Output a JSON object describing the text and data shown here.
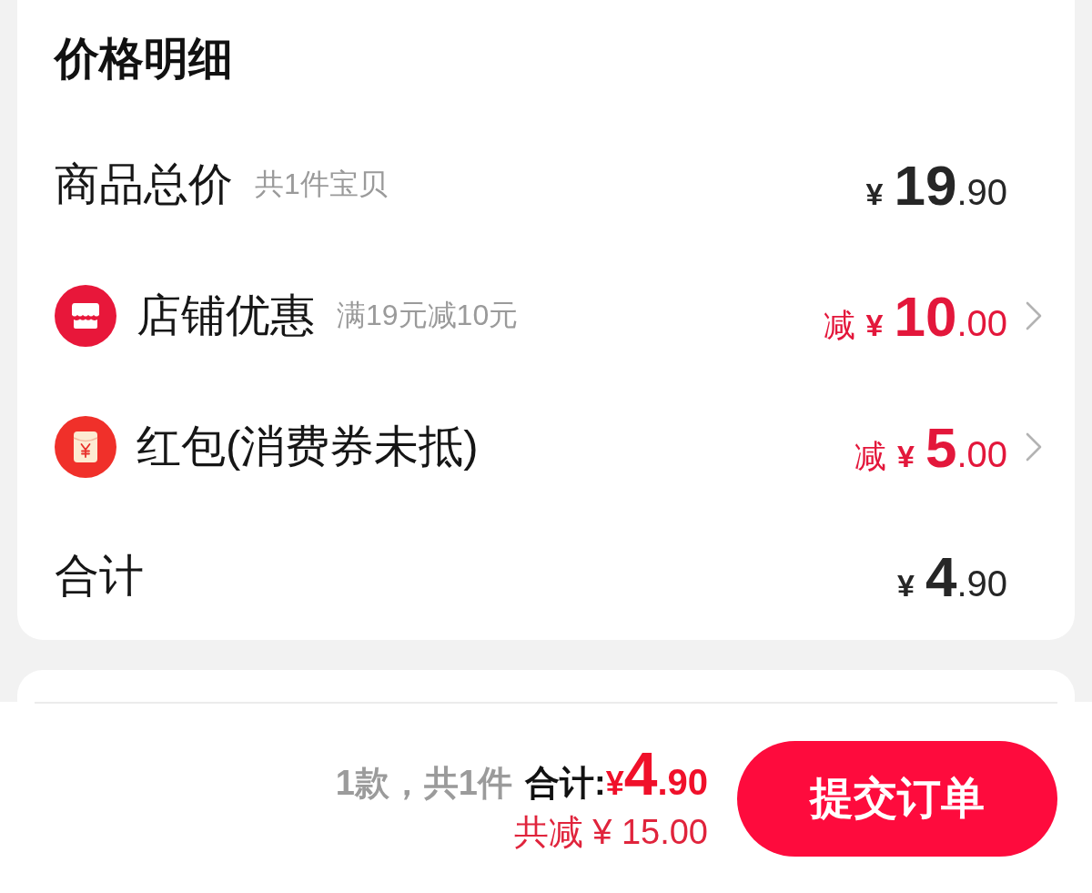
{
  "price_detail": {
    "title": "价格明细",
    "rows": [
      {
        "kind": "plain",
        "label": "商品总价",
        "note": "共1件宝贝",
        "price": {
          "currency": "¥",
          "whole": "19",
          "fraction": ".90"
        }
      },
      {
        "kind": "shop",
        "label": "店铺优惠",
        "note": "满19元减10元",
        "prefix": "减",
        "price": {
          "currency": "¥",
          "whole": "10",
          "fraction": ".00"
        }
      },
      {
        "kind": "packet",
        "label": "红包(消费券未抵)",
        "prefix": "减",
        "price": {
          "currency": "¥",
          "whole": "5",
          "fraction": ".00"
        }
      },
      {
        "kind": "plain",
        "label": "合计",
        "price": {
          "currency": "¥",
          "whole": "4",
          "fraction": ".90"
        }
      }
    ]
  },
  "checkout_bar": {
    "item_count": "1款，共1件",
    "total_label": "合计:",
    "total": {
      "currency": "¥",
      "whole": "4",
      "fraction": ".90"
    },
    "savings": "共减 ¥ 15.00",
    "submit_button": "提交订单"
  }
}
